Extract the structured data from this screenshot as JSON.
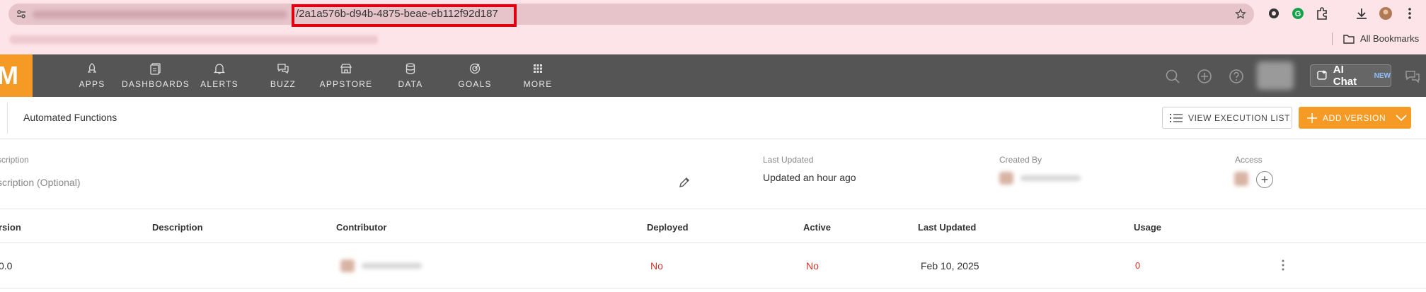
{
  "browser": {
    "url_visible": "/2a1a576b-d94b-4875-beae-eb112f92d187",
    "bookmarks_label": "All Bookmarks"
  },
  "appbar": {
    "logo_text": "M",
    "nav": [
      {
        "label": "APPS",
        "icon": "rocket-icon"
      },
      {
        "label": "DASHBOARDS",
        "icon": "dashboards-icon"
      },
      {
        "label": "ALERTS",
        "icon": "bell-icon"
      },
      {
        "label": "BUZZ",
        "icon": "chat-bubbles-icon"
      },
      {
        "label": "APPSTORE",
        "icon": "store-icon"
      },
      {
        "label": "DATA",
        "icon": "database-icon"
      },
      {
        "label": "GOALS",
        "icon": "target-icon"
      },
      {
        "label": "MORE",
        "icon": "grid-icon"
      }
    ],
    "ai_chat_label": "AI Chat",
    "ai_chat_badge": "NEW"
  },
  "subheader": {
    "title": "Automated Functions",
    "view_execution_list_label": "VIEW EXECUTION LIST",
    "add_version_label": "ADD VERSION"
  },
  "info": {
    "description_label": "scription",
    "description_placeholder": "scription (Optional)",
    "last_updated_label": "Last Updated",
    "last_updated_value": "Updated an hour ago",
    "created_by_label": "Created By",
    "access_label": "Access"
  },
  "table": {
    "headers": [
      "rsion",
      "Description",
      "Contributor",
      "Deployed",
      "Active",
      "Last Updated",
      "Usage"
    ],
    "rows": [
      {
        "version": "0.0",
        "description": "",
        "deployed": "No",
        "active": "No",
        "last_updated": "Feb 10, 2025",
        "usage": "0"
      }
    ]
  },
  "colors": {
    "accent": "#f69a26",
    "appbar": "#555555",
    "negative": "#d0332a",
    "url_highlight": "#e00010"
  }
}
